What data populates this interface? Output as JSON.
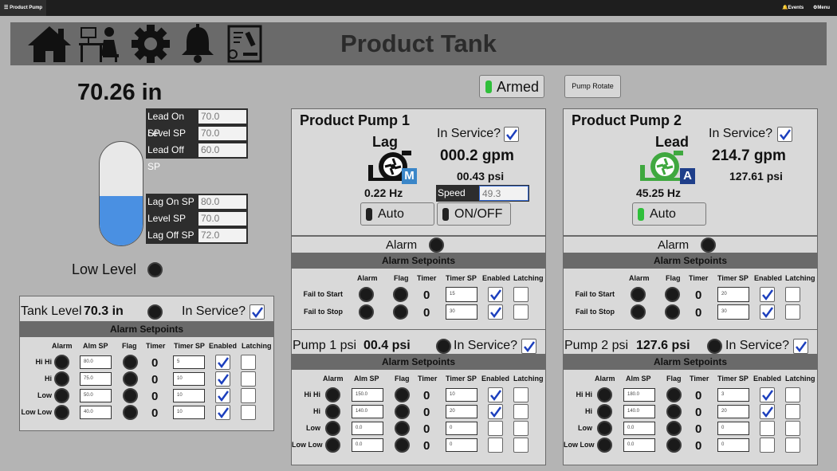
{
  "topbar": {
    "brand": "Product Pump",
    "events": "Events",
    "menu": "Menu"
  },
  "header": {
    "title": "Product Tank"
  },
  "tank": {
    "level_value": "70.26 in",
    "fill_fraction": 0.48,
    "setpoints_top": [
      {
        "label": "Lead On SP",
        "value": "70.0"
      },
      {
        "label": "Level SP",
        "value": "70.0"
      },
      {
        "label": "Lead Off SP",
        "value": "60.0"
      }
    ],
    "setpoints_bottom": [
      {
        "label": "Lag On SP",
        "value": "80.0"
      },
      {
        "label": "Level SP",
        "value": "70.0"
      },
      {
        "label": "Lag Off SP",
        "value": "72.0"
      }
    ],
    "low_level_label": "Low Level"
  },
  "armed": {
    "label": "Armed",
    "color": "#2fbf3a"
  },
  "pump_rotate": {
    "label": "Pump Rotate"
  },
  "tank_level": {
    "label": "Tank Level",
    "value": "70.3 in",
    "in_service": "In Service?",
    "band": "Alarm Setpoints",
    "headers": [
      "Alarm",
      "Alm SP",
      "Flag",
      "Timer",
      "Timer SP",
      "Enabled",
      "Latching"
    ],
    "rows": [
      {
        "name": "Hi Hi",
        "alm_sp": "80.0",
        "timer": "0",
        "timer_sp": "5",
        "enabled": true,
        "latching": false
      },
      {
        "name": "Hi",
        "alm_sp": "75.0",
        "timer": "0",
        "timer_sp": "10",
        "enabled": true,
        "latching": false
      },
      {
        "name": "Low",
        "alm_sp": "50.0",
        "timer": "0",
        "timer_sp": "10",
        "enabled": true,
        "latching": false
      },
      {
        "name": "Low Low",
        "alm_sp": "40.0",
        "timer": "0",
        "timer_sp": "10",
        "enabled": true,
        "latching": false
      }
    ]
  },
  "pumps": [
    {
      "title": "Product Pump 1",
      "in_service": "In Service?",
      "role": "Lag",
      "flow": "000.2 gpm",
      "psi": "00.43 psi",
      "hz": "0.22 Hz",
      "speed_label": "Speed",
      "speed_value": "49.3",
      "mode_badge": "M",
      "pump_color": "#111111",
      "badge_color": "#3a86c8",
      "auto_label": "Auto",
      "auto_color": "#222222",
      "onoff_label": "ON/OFF",
      "onoff_color": "#222222",
      "alarm_label": "Alarm",
      "band": "Alarm Setpoints",
      "fail_headers": [
        "Alarm",
        "Flag",
        "Timer",
        "Timer SP",
        "Enabled",
        "Latching"
      ],
      "fail_rows": [
        {
          "name": "Fail to Start",
          "timer": "0",
          "timer_sp": "15",
          "enabled": true,
          "latching": false
        },
        {
          "name": "Fail to Stop",
          "timer": "0",
          "timer_sp": "30",
          "enabled": true,
          "latching": false
        }
      ],
      "psi_label": "Pump 1 psi",
      "psi_value": "00.4 psi",
      "psi_in_service": "In Service?",
      "psi_band": "Alarm Setpoints",
      "psi_headers": [
        "Alarm",
        "Alm SP",
        "Flag",
        "Timer",
        "Timer SP",
        "Enabled",
        "Latching"
      ],
      "psi_rows": [
        {
          "name": "Hi Hi",
          "alm_sp": "150.0",
          "timer": "0",
          "timer_sp": "10",
          "enabled": true,
          "latching": false
        },
        {
          "name": "Hi",
          "alm_sp": "140.0",
          "timer": "0",
          "timer_sp": "20",
          "enabled": true,
          "latching": false
        },
        {
          "name": "Low",
          "alm_sp": "0.0",
          "timer": "0",
          "timer_sp": "0",
          "enabled": false,
          "latching": false
        },
        {
          "name": "Low Low",
          "alm_sp": "0.0",
          "timer": "0",
          "timer_sp": "0",
          "enabled": false,
          "latching": false
        }
      ]
    },
    {
      "title": "Product Pump 2",
      "in_service": "In Service?",
      "role": "Lead",
      "flow": "214.7 gpm",
      "psi": "127.61 psi",
      "hz": "45.25 Hz",
      "mode_badge": "A",
      "pump_color": "#3fa83f",
      "badge_color": "#1f3f8a",
      "auto_label": "Auto",
      "auto_color": "#2fbf3a",
      "alarm_label": "Alarm",
      "band": "Alarm Setpoints",
      "fail_headers": [
        "Alarm",
        "Flag",
        "Timer",
        "Timer SP",
        "Enabled",
        "Latching"
      ],
      "fail_rows": [
        {
          "name": "Fail to Start",
          "timer": "0",
          "timer_sp": "20",
          "enabled": true,
          "latching": false
        },
        {
          "name": "Fail to Stop",
          "timer": "0",
          "timer_sp": "30",
          "enabled": true,
          "latching": false
        }
      ],
      "psi_label": "Pump 2 psi",
      "psi_value": "127.6 psi",
      "psi_in_service": "In Service?",
      "psi_band": "Alarm Setpoints",
      "psi_headers": [
        "Alarm",
        "Alm SP",
        "Flag",
        "Timer",
        "Timer SP",
        "Enabled",
        "Latching"
      ],
      "psi_rows": [
        {
          "name": "Hi Hi",
          "alm_sp": "180.0",
          "timer": "0",
          "timer_sp": "3",
          "enabled": true,
          "latching": false
        },
        {
          "name": "Hi",
          "alm_sp": "140.0",
          "timer": "0",
          "timer_sp": "20",
          "enabled": true,
          "latching": false
        },
        {
          "name": "Low",
          "alm_sp": "0.0",
          "timer": "0",
          "timer_sp": "0",
          "enabled": false,
          "latching": false
        },
        {
          "name": "Low Low",
          "alm_sp": "0.0",
          "timer": "0",
          "timer_sp": "0",
          "enabled": false,
          "latching": false
        }
      ]
    }
  ]
}
